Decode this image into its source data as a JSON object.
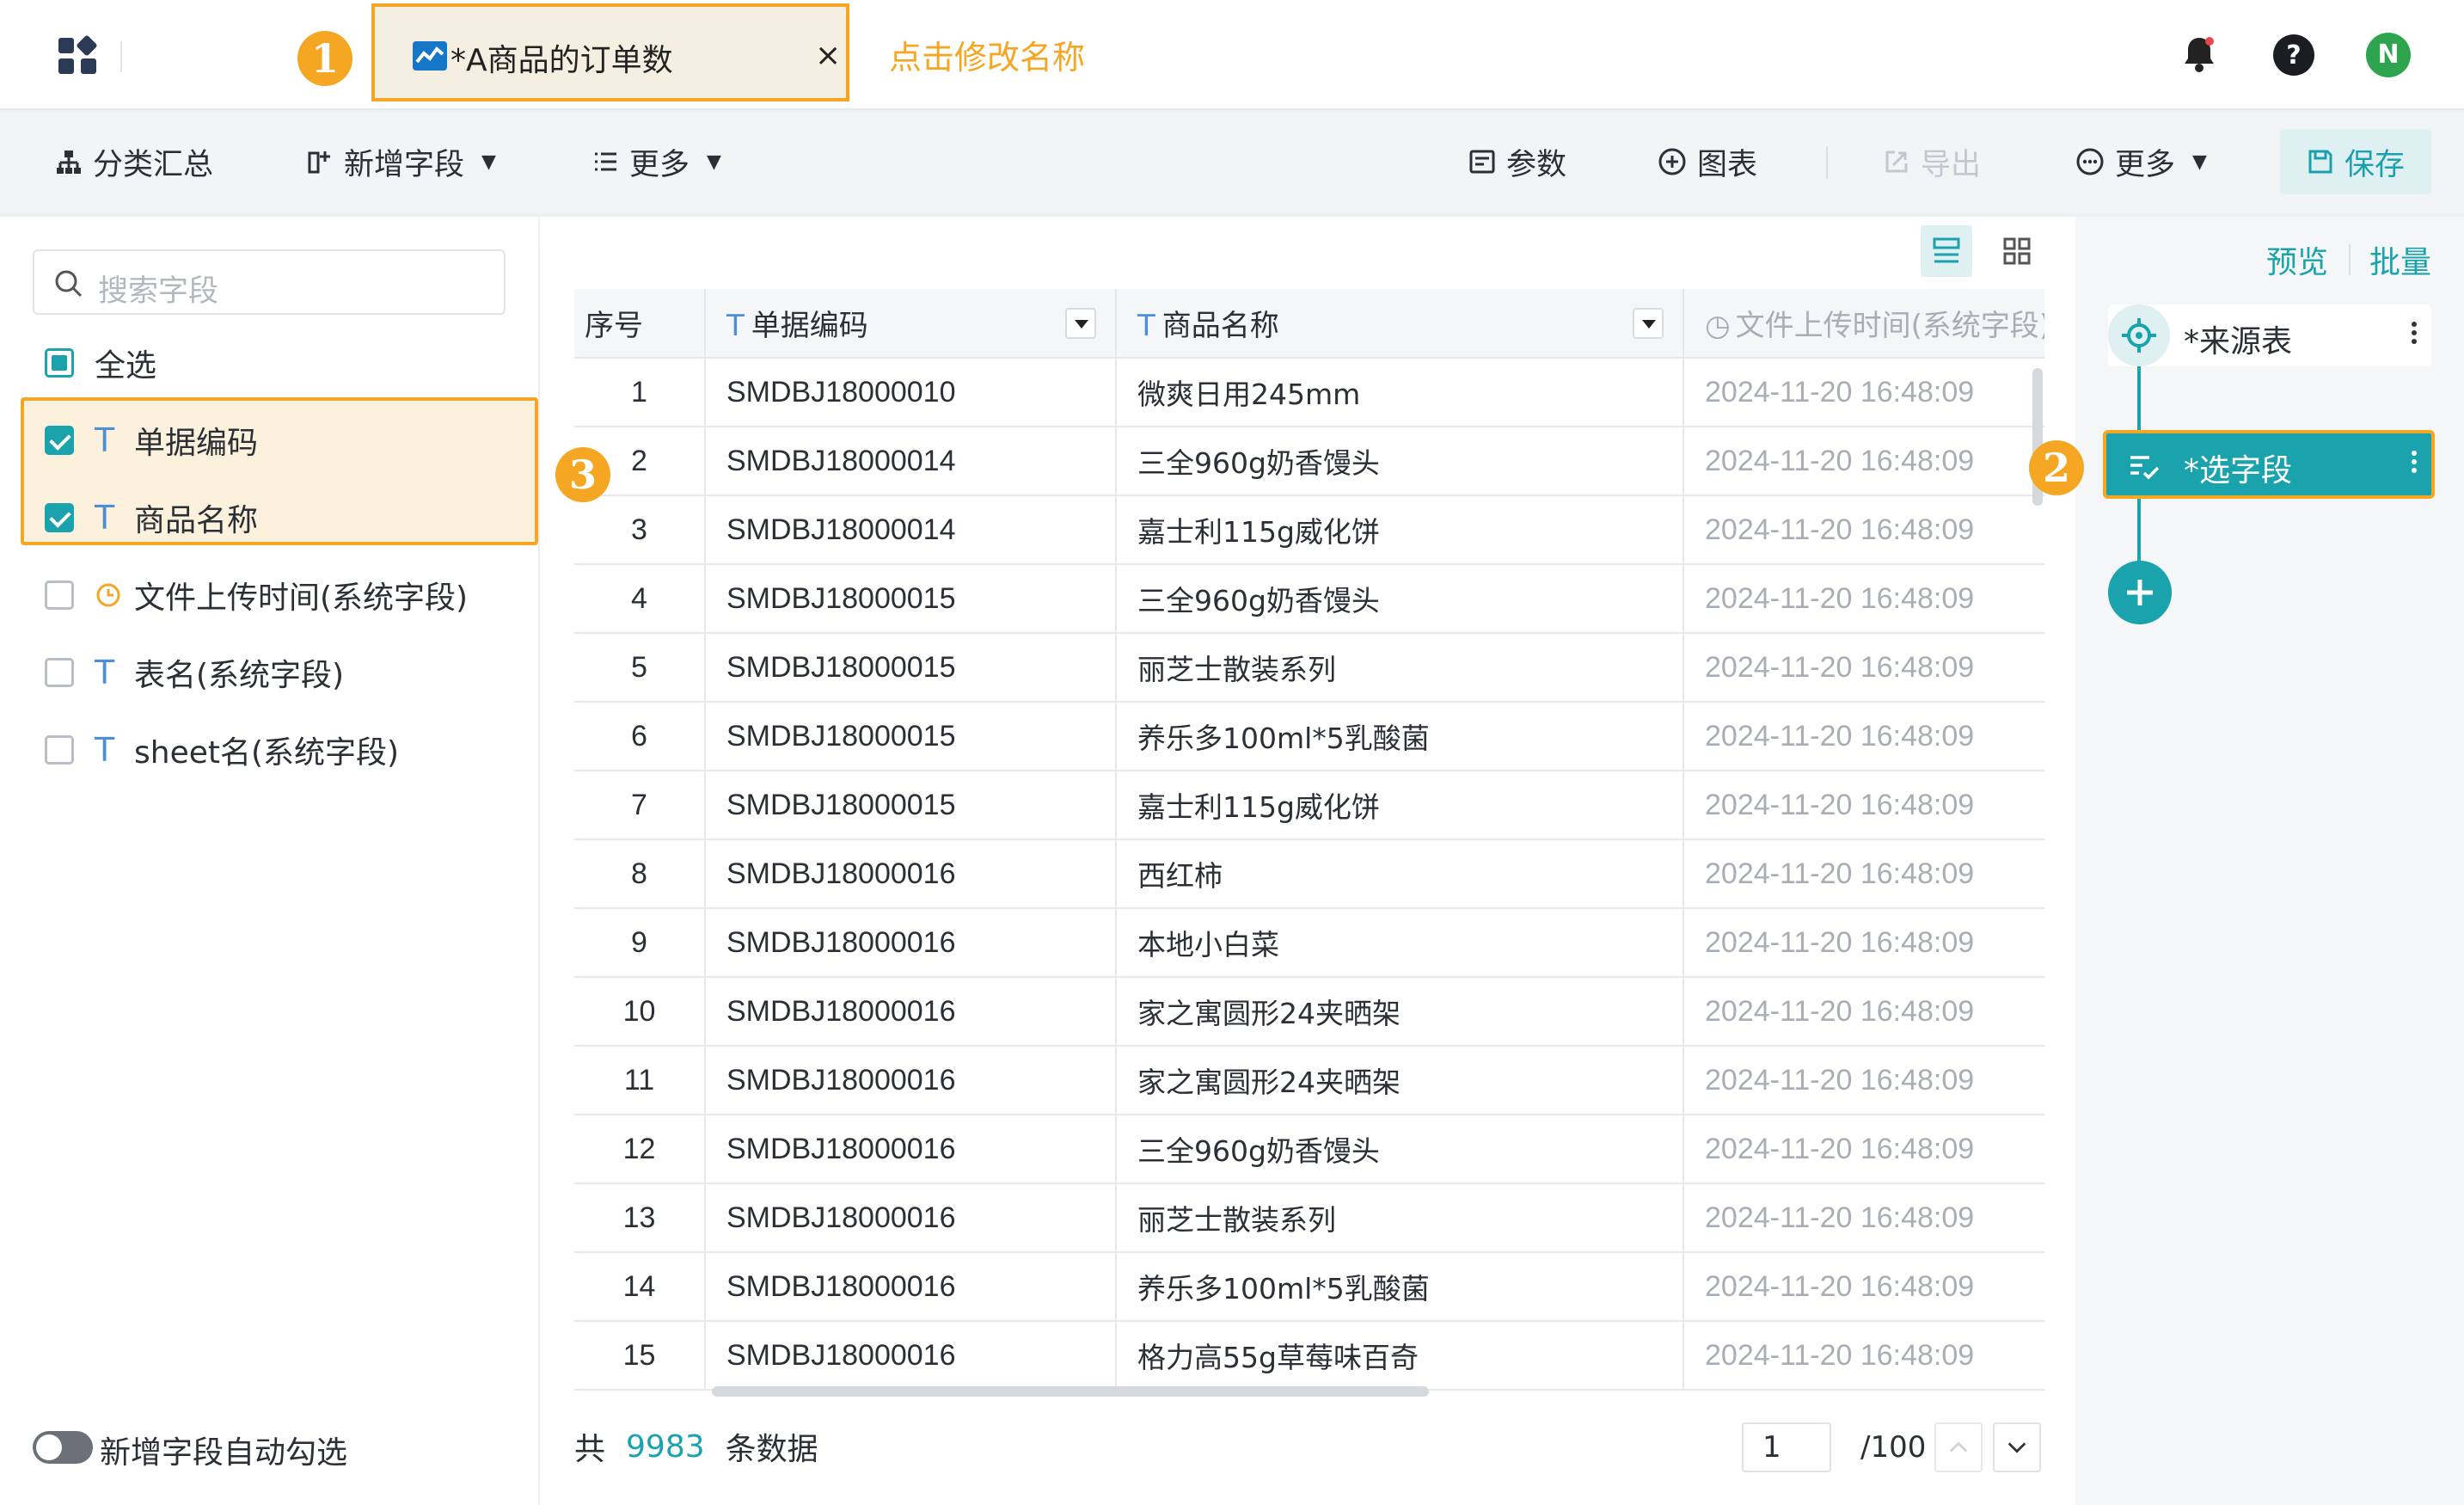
{
  "tab": {
    "title": "*A商品的订单数",
    "close": "×"
  },
  "header": {
    "rename_hint": "点击修改名称"
  },
  "badges": [
    "1",
    "2",
    "3"
  ],
  "toolbar": {
    "group_summary": "分类汇总",
    "add_field": "新增字段",
    "more_left": "更多",
    "params": "参数",
    "chart": "图表",
    "export": "导出",
    "more_right": "更多",
    "save": "保存"
  },
  "left_panel": {
    "search_placeholder": "搜索字段",
    "select_all": "全选",
    "fields": [
      {
        "label": "单据编码",
        "type": "text",
        "checked": true
      },
      {
        "label": "商品名称",
        "type": "text",
        "checked": true
      },
      {
        "label": "文件上传时间(系统字段)",
        "type": "time",
        "checked": false
      },
      {
        "label": "表名(系统字段)",
        "type": "text",
        "checked": false
      },
      {
        "label": "sheet名(系统字段)",
        "type": "text",
        "checked": false
      }
    ],
    "auto_check_label": "新增字段自动勾选"
  },
  "grid": {
    "columns": [
      "序号",
      "单据编码",
      "商品名称",
      "文件上传时间(系统字段)"
    ],
    "rows": [
      [
        "1",
        "SMDBJ18000010",
        "微爽日用245mm",
        "2024-11-20 16:48:09"
      ],
      [
        "2",
        "SMDBJ18000014",
        "三全960g奶香馒头",
        "2024-11-20 16:48:09"
      ],
      [
        "3",
        "SMDBJ18000014",
        "嘉士利115g威化饼",
        "2024-11-20 16:48:09"
      ],
      [
        "4",
        "SMDBJ18000015",
        "三全960g奶香馒头",
        "2024-11-20 16:48:09"
      ],
      [
        "5",
        "SMDBJ18000015",
        "丽芝士散装系列",
        "2024-11-20 16:48:09"
      ],
      [
        "6",
        "SMDBJ18000015",
        "养乐多100ml*5乳酸菌",
        "2024-11-20 16:48:09"
      ],
      [
        "7",
        "SMDBJ18000015",
        "嘉士利115g威化饼",
        "2024-11-20 16:48:09"
      ],
      [
        "8",
        "SMDBJ18000016",
        "西红柿",
        "2024-11-20 16:48:09"
      ],
      [
        "9",
        "SMDBJ18000016",
        "本地小白菜",
        "2024-11-20 16:48:09"
      ],
      [
        "10",
        "SMDBJ18000016",
        "家之寓圆形24夹晒架",
        "2024-11-20 16:48:09"
      ],
      [
        "11",
        "SMDBJ18000016",
        "家之寓圆形24夹晒架",
        "2024-11-20 16:48:09"
      ],
      [
        "12",
        "SMDBJ18000016",
        "三全960g奶香馒头",
        "2024-11-20 16:48:09"
      ],
      [
        "13",
        "SMDBJ18000016",
        "丽芝士散装系列",
        "2024-11-20 16:48:09"
      ],
      [
        "14",
        "SMDBJ18000016",
        "养乐多100ml*5乳酸菌",
        "2024-11-20 16:48:09"
      ],
      [
        "15",
        "SMDBJ18000016",
        "格力高55g草莓味百奇",
        "2024-11-20 16:48:09"
      ]
    ]
  },
  "footer": {
    "prefix": "共",
    "total": "9983",
    "suffix": "条数据",
    "page": "1",
    "page_total": "/100"
  },
  "right_panel": {
    "preview": "预览",
    "batch": "批量",
    "node_source": "*来源表",
    "node_select": "*选字段"
  },
  "user": {
    "initial": "N"
  },
  "colors": {
    "accent": "#1aa3ad",
    "highlight": "#f5a623",
    "link": "#4b8fd8"
  }
}
